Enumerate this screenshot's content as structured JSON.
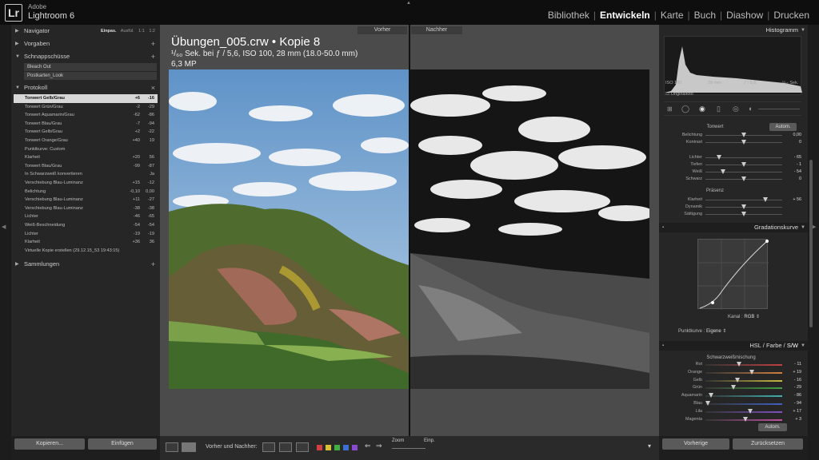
{
  "app": {
    "brand_small": "Adobe",
    "brand_name": "Lightroom 6",
    "logo": "Lr"
  },
  "modules": [
    "Bibliothek",
    "Entwickeln",
    "Karte",
    "Buch",
    "Diashow",
    "Drucken"
  ],
  "active_module": "Entwickeln",
  "left": {
    "navigator": {
      "label": "Navigator",
      "opts": [
        "Einpas.",
        "Ausfül.",
        "1:1",
        "1:2"
      ]
    },
    "presets": {
      "label": "Vorgaben"
    },
    "snapshots": {
      "label": "Schnappschüsse",
      "items": [
        "Bleach Out",
        "Postkarten_Look"
      ]
    },
    "history": {
      "label": "Protokoll",
      "items": [
        {
          "name": "Tonwert Gelb/Grau",
          "a": "+6",
          "b": "-16"
        },
        {
          "name": "Tonwert Grün/Grau",
          "a": "-2",
          "b": "-29"
        },
        {
          "name": "Tonwert Aquamarin/Grau",
          "a": "-62",
          "b": "-86"
        },
        {
          "name": "Tonwert Blau/Grau",
          "a": "-7",
          "b": "-94"
        },
        {
          "name": "Tonwert Gelb/Grau",
          "a": "+2",
          "b": "-22"
        },
        {
          "name": "Tonwert Orange/Grau",
          "a": "+40",
          "b": "19"
        },
        {
          "name": "Punktkurve: Custom",
          "a": "",
          "b": ""
        },
        {
          "name": "Klarheit",
          "a": "+20",
          "b": "56"
        },
        {
          "name": "Tonwert Blau/Grau",
          "a": "-99",
          "b": "-87"
        },
        {
          "name": "In Schwarzweiß konvertieren",
          "a": "",
          "b": "Ja"
        },
        {
          "name": "Verschiebung Blau-Luminanz",
          "a": "+15",
          "b": "-12"
        },
        {
          "name": "Belichtung",
          "a": "-0,10",
          "b": "0,00"
        },
        {
          "name": "Verschiebung Blau-Luminanz",
          "a": "+11",
          "b": "-27"
        },
        {
          "name": "Verschiebung Blau-Luminanz",
          "a": "-38",
          "b": "-38"
        },
        {
          "name": "Lichter",
          "a": "-46",
          "b": "-65"
        },
        {
          "name": "Weiß-Beschneidung",
          "a": "-54",
          "b": "-54"
        },
        {
          "name": "Lichter",
          "a": "-19",
          "b": "-19"
        },
        {
          "name": "Klarheit",
          "a": "+36",
          "b": "36"
        },
        {
          "name": "Virtuelle Kopie erstellen (29.12.15_53 19:43:15)",
          "a": "",
          "b": ""
        }
      ]
    },
    "collections": {
      "label": "Sammlungen"
    },
    "copy_btn": "Kopieren...",
    "paste_btn": "Einfügen"
  },
  "center": {
    "before_label": "Vorher",
    "after_label": "Nachher",
    "title": "Übungen_005.crw • Kopie 8",
    "meta": "¹/₆₀ Sek. bei ƒ / 5,6, ISO 100, 28 mm (18.0-50.0 mm)",
    "mp": "6,3 MP"
  },
  "toolbar": {
    "before_after_label": "Vorher und Nachher:",
    "zoom_label": "Zoom",
    "fit_label": "Einp.",
    "swatches": [
      "#d04040",
      "#d8c030",
      "#40b040",
      "#3b6fd0",
      "#8a4ad0"
    ]
  },
  "right": {
    "histogram": {
      "label": "Histogramm",
      "iso": "ISO 100",
      "focal": "28 mm",
      "aperture": "ƒ / 5,6",
      "shutter": "¹/₆₀ Sek.",
      "original": "Originalfoto"
    },
    "basic": {
      "tone_label": "Tonwert",
      "auto": "Autom.",
      "rows": [
        {
          "label": "Belichtung",
          "value": "0,00",
          "pos": 0.5
        },
        {
          "label": "Kontrast",
          "value": "0",
          "pos": 0.5
        },
        {
          "label": "Lichter",
          "value": "- 65",
          "pos": 0.18
        },
        {
          "label": "Tiefen",
          "value": "- 1",
          "pos": 0.5
        },
        {
          "label": "Weiß",
          "value": "- 54",
          "pos": 0.23
        },
        {
          "label": "Schwarz",
          "value": "0",
          "pos": 0.5
        }
      ],
      "presence_label": "Präsenz",
      "presence_rows": [
        {
          "label": "Klarheit",
          "value": "+ 56",
          "pos": 0.78
        },
        {
          "label": "Dynamik",
          "value": "",
          "pos": 0.5
        },
        {
          "label": "Sättigung",
          "value": "",
          "pos": 0.5
        }
      ]
    },
    "curve": {
      "label": "Gradationskurve",
      "channel_label": "Kanal :",
      "channel": "RGB",
      "pointcurve_label": "Punktkurve :",
      "pointcurve": "Eigene"
    },
    "hsl": {
      "tabs": [
        "HSL",
        "Farbe",
        "S/W"
      ],
      "active": "S/W",
      "mix_label": "Schwarzweißmischung",
      "rows": [
        {
          "label": "Rot",
          "value": "- 11",
          "pos": 0.44,
          "color": "#c04040"
        },
        {
          "label": "Orange",
          "value": "+ 19",
          "pos": 0.6,
          "color": "#d08040"
        },
        {
          "label": "Gelb",
          "value": "- 16",
          "pos": 0.42,
          "color": "#c8b840"
        },
        {
          "label": "Grün",
          "value": "- 29",
          "pos": 0.36,
          "color": "#40a040"
        },
        {
          "label": "Aquamarin",
          "value": "- 86",
          "pos": 0.07,
          "color": "#40b0b0"
        },
        {
          "label": "Blau",
          "value": "- 94",
          "pos": 0.03,
          "color": "#4060c0"
        },
        {
          "label": "Lila",
          "value": "+ 17",
          "pos": 0.58,
          "color": "#8050c0"
        },
        {
          "label": "Magenta",
          "value": "+ 3",
          "pos": 0.52,
          "color": "#c050a0"
        }
      ],
      "auto": "Autom."
    },
    "prev_btn": "Vorherige",
    "reset_btn": "Zurücksetzen"
  }
}
